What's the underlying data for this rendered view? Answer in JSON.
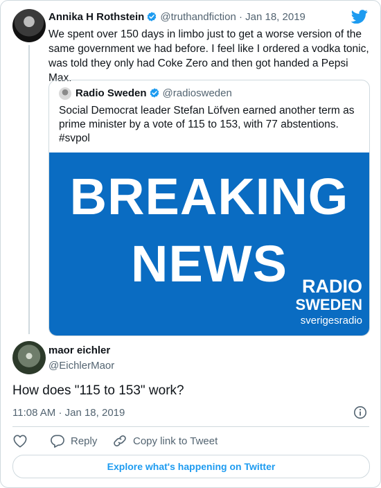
{
  "tweet": {
    "author_name": "Annika H Rothstein",
    "author_handle": "@truthandfiction",
    "separator": "·",
    "date": "Jan 18, 2019",
    "text": "We spent over 150 days in limbo just to get a worse version of the same government we had before. I feel like I ordered a vodka tonic, was told they only had Coke Zero and then got handed a Pepsi Max."
  },
  "quoted": {
    "author_name": "Radio Sweden",
    "author_handle": "@radiosweden",
    "text": "Social Democrat leader Stefan Löfven earned another term as prime minister by a vote of 115 to 153, with 77 abstentions. #svpol",
    "image": {
      "line1": "BREAKING",
      "line2": "NEWS",
      "brand_line1": "RADIO",
      "brand_line2": "SWEDEN",
      "brand_sub": "sverigesradio",
      "background": "#0a6cc2"
    }
  },
  "reply": {
    "author_name": "maor eichler",
    "author_handle": "@EichlerMaor",
    "text": "How does \"115 to 153\" work?",
    "time": "11:08 AM",
    "separator": "·",
    "date": "Jan 18, 2019"
  },
  "actions": {
    "like_icon": "heart-icon",
    "reply_label": "Reply",
    "copy_label": "Copy link to Tweet"
  },
  "explore_label": "Explore what's happening on Twitter",
  "colors": {
    "accent": "#1d9bf0",
    "muted": "#536471",
    "border": "#cfd9de"
  }
}
